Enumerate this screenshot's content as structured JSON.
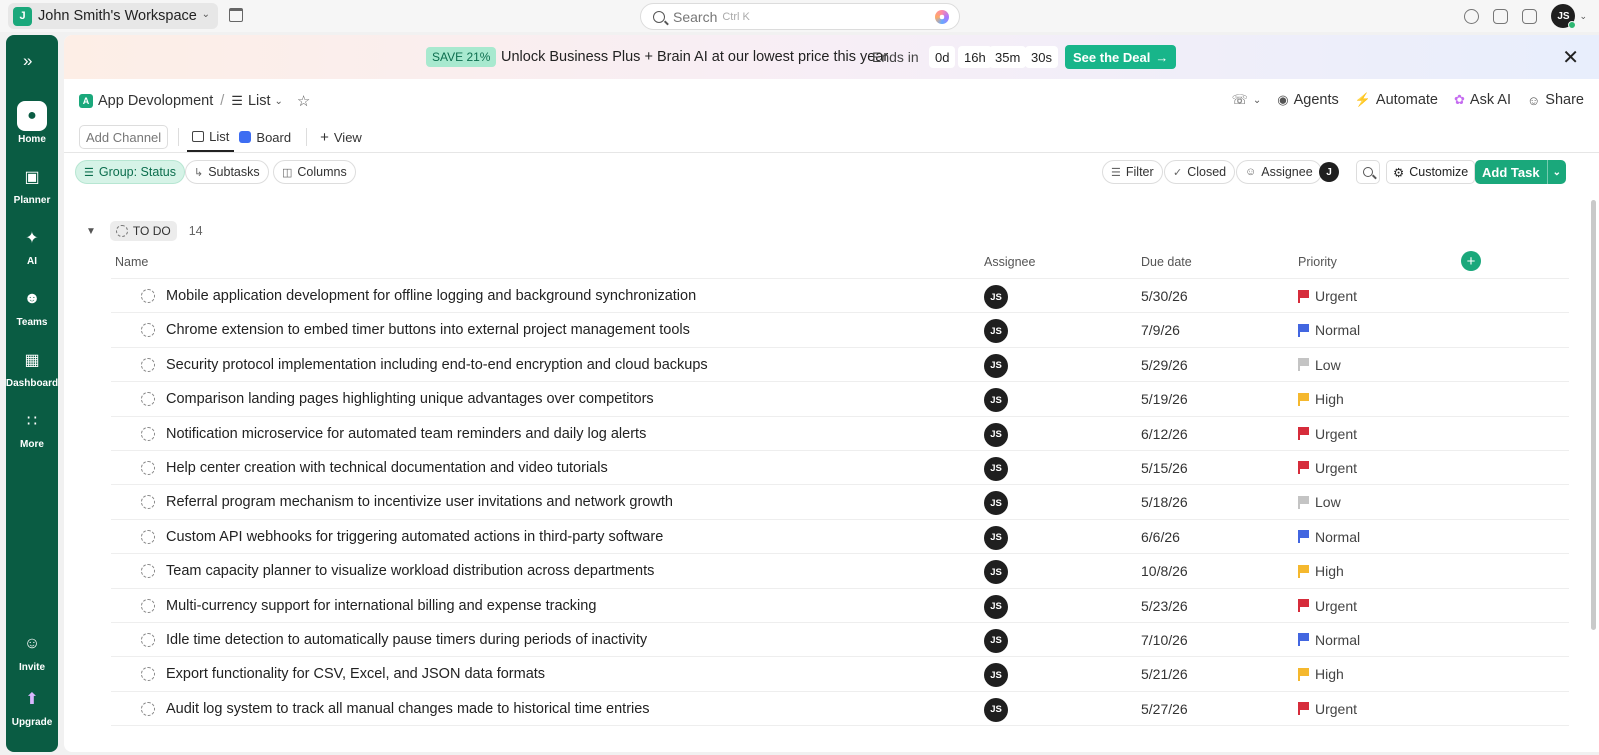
{
  "workspace": {
    "initial": "J",
    "name": "John Smith's Workspace"
  },
  "search": {
    "label": "Search",
    "shortcut": "Ctrl K"
  },
  "user": {
    "initials": "JS"
  },
  "sidebar": {
    "items": [
      {
        "label": "Home",
        "icon": "home-icon"
      },
      {
        "label": "Planner",
        "icon": "planner-icon"
      },
      {
        "label": "AI",
        "icon": "ai-icon"
      },
      {
        "label": "Teams",
        "icon": "teams-icon"
      },
      {
        "label": "Dashboard",
        "icon": "dashboard-icon"
      },
      {
        "label": "More",
        "icon": "more-icon"
      },
      {
        "label": "Invite",
        "icon": "invite-icon"
      },
      {
        "label": "Upgrade",
        "icon": "upgrade-icon"
      }
    ]
  },
  "banner": {
    "badge": "SAVE 21%",
    "text": "Unlock Business Plus + Brain AI at our lowest price this year",
    "ends_in": "Ends in",
    "timer": [
      "0d",
      "16h",
      "35m",
      "30s"
    ],
    "cta": "See the Deal"
  },
  "breadcrumb": {
    "space_initial": "A",
    "space": "App Devolopment",
    "sep": "/",
    "view": "List"
  },
  "header_actions": {
    "agents": "Agents",
    "automate": "Automate",
    "ask_ai": "Ask AI",
    "share": "Share"
  },
  "views": {
    "add_channel": "Add Channel",
    "list": "List",
    "board": "Board",
    "add_view": "View"
  },
  "filters": {
    "group": "Group: Status",
    "subtasks": "Subtasks",
    "columns": "Columns",
    "filter": "Filter",
    "closed": "Closed",
    "assignee": "Assignee",
    "assignee_avatar": "J",
    "customize": "Customize",
    "add_task": "Add Task"
  },
  "group": {
    "status": "TO DO",
    "count": "14"
  },
  "columns": {
    "name": "Name",
    "assignee": "Assignee",
    "due": "Due date",
    "priority": "Priority"
  },
  "priority_colors": {
    "Urgent": "#d62c3b",
    "Normal": "#4266e0",
    "Low": "#c4c4c4",
    "High": "#f5b82e"
  },
  "tasks": [
    {
      "name": "Mobile application development for offline logging and background synchronization",
      "assignee": "JS",
      "due": "5/30/26",
      "priority": "Urgent"
    },
    {
      "name": "Chrome extension to embed timer buttons into external project management tools",
      "assignee": "JS",
      "due": "7/9/26",
      "priority": "Normal"
    },
    {
      "name": "Security protocol implementation including end-to-end encryption and cloud backups",
      "assignee": "JS",
      "due": "5/29/26",
      "priority": "Low"
    },
    {
      "name": "Comparison landing pages highlighting unique advantages over competitors",
      "assignee": "JS",
      "due": "5/19/26",
      "priority": "High"
    },
    {
      "name": "Notification microservice for automated team reminders and daily log alerts",
      "assignee": "JS",
      "due": "6/12/26",
      "priority": "Urgent"
    },
    {
      "name": "Help center creation with technical documentation and video tutorials",
      "assignee": "JS",
      "due": "5/15/26",
      "priority": "Urgent"
    },
    {
      "name": "Referral program mechanism to incentivize user invitations and network growth",
      "assignee": "JS",
      "due": "5/18/26",
      "priority": "Low"
    },
    {
      "name": "Custom API webhooks for triggering automated actions in third-party software",
      "assignee": "JS",
      "due": "6/6/26",
      "priority": "Normal"
    },
    {
      "name": "Team capacity planner to visualize workload distribution across departments",
      "assignee": "JS",
      "due": "10/8/26",
      "priority": "High"
    },
    {
      "name": "Multi-currency support for international billing and expense tracking",
      "assignee": "JS",
      "due": "5/23/26",
      "priority": "Urgent"
    },
    {
      "name": "Idle time detection to automatically pause timers during periods of inactivity",
      "assignee": "JS",
      "due": "7/10/26",
      "priority": "Normal"
    },
    {
      "name": "Export functionality for CSV, Excel, and JSON data formats",
      "assignee": "JS",
      "due": "5/21/26",
      "priority": "High"
    },
    {
      "name": "Audit log system to track all manual changes made to historical time entries",
      "assignee": "JS",
      "due": "5/27/26",
      "priority": "Urgent"
    }
  ]
}
